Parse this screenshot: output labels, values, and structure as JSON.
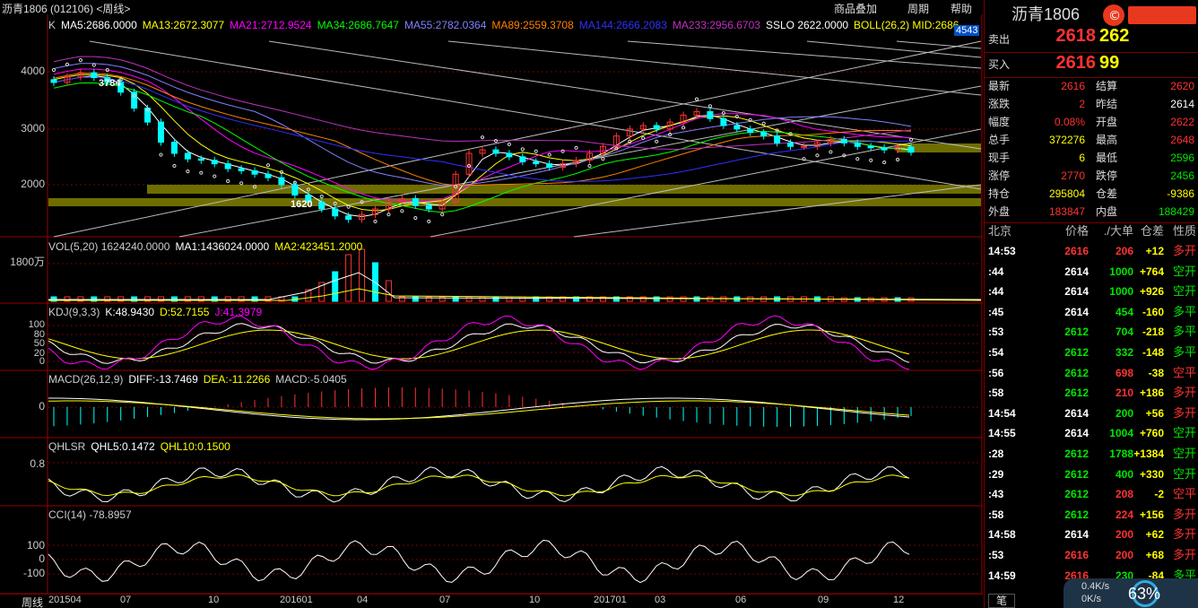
{
  "app": {
    "title": "沥青1806 (012106) <周线>",
    "buttons": [
      "商品叠加",
      "周期",
      "帮助"
    ]
  },
  "legend": {
    "main": [
      {
        "t": "K",
        "c": "#cccccc"
      },
      {
        "t": "MA5:2686.0000",
        "c": "#ffffff"
      },
      {
        "t": "MA13:2672.3077",
        "c": "#ffff00"
      },
      {
        "t": "MA21:2712.9524",
        "c": "#ff00ff"
      },
      {
        "t": "MA34:2686.7647",
        "c": "#00ff00"
      },
      {
        "t": "MA55:2782.0364",
        "c": "#8080ff"
      },
      {
        "t": "MA89:2559.3708",
        "c": "#ff8000"
      },
      {
        "t": "MA144:2666.2083",
        "c": "#3030ff"
      },
      {
        "t": "MA233:2956.6703",
        "c": "#c030c0"
      },
      {
        "t": "SSLO 2622.0000",
        "c": "#ffffff"
      },
      {
        "t": "BOLL(26,2) MID:2686",
        "c": "#ffff00"
      }
    ],
    "vol": [
      {
        "t": "VOL(5,20) 1624240.0000",
        "c": "#cccccc"
      },
      {
        "t": "MA1:1436024.0000",
        "c": "#ffffff"
      },
      {
        "t": "MA2:423451.2000",
        "c": "#ffff00"
      }
    ],
    "kdj": [
      {
        "t": "KDJ(9,3,3)",
        "c": "#cccccc"
      },
      {
        "t": "K:48.9430",
        "c": "#ffffff"
      },
      {
        "t": "D:52.7155",
        "c": "#ffff00"
      },
      {
        "t": "J:41.3979",
        "c": "#ff00ff"
      }
    ],
    "macd": [
      {
        "t": "MACD(26,12,9)",
        "c": "#cccccc"
      },
      {
        "t": "DIFF:-13.7469",
        "c": "#ffffff"
      },
      {
        "t": "DEA:-11.2266",
        "c": "#ffff00"
      },
      {
        "t": "MACD:-5.0405",
        "c": "#cccccc"
      }
    ],
    "qhl": [
      {
        "t": "QHLSR",
        "c": "#cccccc"
      },
      {
        "t": "QHL5:0.1472",
        "c": "#ffffff"
      },
      {
        "t": "QHL10:0.1500",
        "c": "#ffff00"
      }
    ],
    "cci": [
      {
        "t": "CCI(14) -78.8957",
        "c": "#cccccc"
      }
    ]
  },
  "yaxis": {
    "main": [
      "4000",
      "3000",
      "2000"
    ],
    "vol": [
      "1800万"
    ],
    "kdj": [
      "100",
      "80",
      "50",
      "20",
      "0"
    ],
    "macd": [
      "0"
    ],
    "qhl": [
      "0.8"
    ],
    "cci": [
      "100",
      "0",
      "-100"
    ]
  },
  "price_badge": "4543",
  "annotations": {
    "high": "3784",
    "low": "1620"
  },
  "xaxis": [
    "201504",
    "07",
    "10",
    "201601",
    "04",
    "07",
    "10",
    "201701",
    "03",
    "06",
    "09",
    "12"
  ],
  "bottom_left": "周线",
  "chart_data": {
    "type": "candlestick",
    "period": "weekly",
    "price_range": [
      1400,
      4600
    ],
    "close_approx": [
      3620,
      3700,
      3760,
      3690,
      3620,
      3480,
      3250,
      3050,
      2760,
      2600,
      2520,
      2500,
      2450,
      2380,
      2350,
      2300,
      2250,
      2150,
      2000,
      1900,
      1800,
      1700,
      1650,
      1720,
      1800,
      1900,
      1950,
      1850,
      1800,
      1900,
      2300,
      2600,
      2650,
      2600,
      2550,
      2480,
      2450,
      2400,
      2450,
      2500,
      2600,
      2700,
      2850,
      2950,
      3000,
      2950,
      3050,
      3150,
      3200,
      3100,
      3000,
      2950,
      2900,
      2850,
      2750,
      2700,
      2700,
      2750,
      2800,
      2750,
      2700,
      2680,
      2650,
      2690,
      2616
    ],
    "volume_peak": "1800万"
  },
  "quote": {
    "name": "沥青1806",
    "ask": {
      "label": "卖出",
      "price": "2618",
      "vol": "262"
    },
    "bid": {
      "label": "买入",
      "price": "2616",
      "vol": "99"
    },
    "stats": [
      {
        "k1": "最新",
        "v1": "2616",
        "c1": "red",
        "k2": "结算",
        "v2": "2620",
        "c2": "red"
      },
      {
        "k1": "涨跌",
        "v1": "2",
        "c1": "red",
        "k2": "昨结",
        "v2": "2614",
        "c2": "white"
      },
      {
        "k1": "幅度",
        "v1": "0.08%",
        "c1": "red",
        "k2": "开盘",
        "v2": "2622",
        "c2": "red"
      },
      {
        "k1": "总手",
        "v1": "372276",
        "c1": "yellow",
        "k2": "最高",
        "v2": "2648",
        "c2": "red"
      },
      {
        "k1": "现手",
        "v1": "6",
        "c1": "yellow",
        "k2": "最低",
        "v2": "2596",
        "c2": "green"
      },
      {
        "k1": "涨停",
        "v1": "2770",
        "c1": "red",
        "k2": "跌停",
        "v2": "2456",
        "c2": "green"
      },
      {
        "k1": "持仓",
        "v1": "295804",
        "c1": "yellow",
        "k2": "仓差",
        "v2": "-9386",
        "c2": "yellow"
      },
      {
        "k1": "外盘",
        "v1": "183847",
        "c1": "red",
        "k2": "内盘",
        "v2": "188429",
        "c2": "green"
      }
    ],
    "tick_header": [
      "北京",
      "价格",
      "./大单",
      "仓差",
      "性质"
    ],
    "ticks": [
      {
        "t": "14:53",
        "p": "2616",
        "pc": "red",
        "v": "206",
        "vc": "red",
        "d": "+12",
        "n": "多开",
        "nc": "red"
      },
      {
        "t": ":44",
        "p": "2614",
        "pc": "white",
        "v": "1000",
        "vc": "green",
        "d": "+764",
        "n": "空开",
        "nc": "green"
      },
      {
        "t": ":44",
        "p": "2614",
        "pc": "white",
        "v": "1000",
        "vc": "green",
        "d": "+926",
        "n": "空开",
        "nc": "green"
      },
      {
        "t": ":45",
        "p": "2614",
        "pc": "white",
        "v": "454",
        "vc": "green",
        "d": "-160",
        "n": "多平",
        "nc": "green"
      },
      {
        "t": ":53",
        "p": "2612",
        "pc": "green",
        "v": "704",
        "vc": "green",
        "d": "-218",
        "n": "多平",
        "nc": "green"
      },
      {
        "t": ":54",
        "p": "2612",
        "pc": "green",
        "v": "332",
        "vc": "green",
        "d": "-148",
        "n": "多平",
        "nc": "green"
      },
      {
        "t": ":56",
        "p": "2612",
        "pc": "green",
        "v": "698",
        "vc": "red",
        "d": "-38",
        "n": "空平",
        "nc": "red"
      },
      {
        "t": ":58",
        "p": "2612",
        "pc": "green",
        "v": "210",
        "vc": "red",
        "d": "+186",
        "n": "多开",
        "nc": "red"
      },
      {
        "t": "14:54",
        "p": "2614",
        "pc": "white",
        "v": "200",
        "vc": "green",
        "d": "+56",
        "n": "多开",
        "nc": "red"
      },
      {
        "t": "14:55",
        "p": "2614",
        "pc": "white",
        "v": "1004",
        "vc": "green",
        "d": "+760",
        "n": "空开",
        "nc": "green"
      },
      {
        "t": ":28",
        "p": "2612",
        "pc": "green",
        "v": "1788",
        "vc": "green",
        "d": "+1384",
        "n": "空开",
        "nc": "green"
      },
      {
        "t": ":29",
        "p": "2612",
        "pc": "green",
        "v": "400",
        "vc": "green",
        "d": "+330",
        "n": "空开",
        "nc": "green"
      },
      {
        "t": ":43",
        "p": "2612",
        "pc": "green",
        "v": "208",
        "vc": "red",
        "d": "-2",
        "n": "空平",
        "nc": "red"
      },
      {
        "t": ":58",
        "p": "2612",
        "pc": "green",
        "v": "224",
        "vc": "red",
        "d": "+156",
        "n": "多开",
        "nc": "red"
      },
      {
        "t": "14:58",
        "p": "2614",
        "pc": "white",
        "v": "200",
        "vc": "red",
        "d": "+62",
        "n": "多开",
        "nc": "red"
      },
      {
        "t": ":53",
        "p": "2616",
        "pc": "red",
        "v": "200",
        "vc": "red",
        "d": "+68",
        "n": "多开",
        "nc": "red"
      },
      {
        "t": "14:59",
        "p": "2616",
        "pc": "red",
        "v": "230",
        "vc": "green",
        "d": "-84",
        "n": "多平",
        "nc": "green"
      }
    ],
    "speed": "0.4K/s",
    "speed2": "0K/s",
    "percent": "63%",
    "tab": "笔"
  },
  "colors": {
    "up": "#ff3232",
    "down": "#00ffff",
    "grid": "#7a0000",
    "band": "#6e6e00"
  }
}
